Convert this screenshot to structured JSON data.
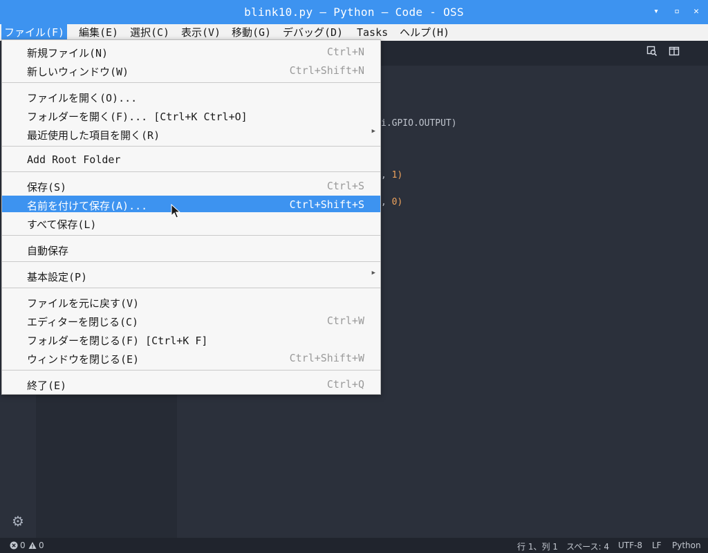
{
  "window": {
    "title": "blink10.py — Python — Code - OSS",
    "minimize_label": "▾",
    "maximize_label": "▫",
    "close_label": "✕"
  },
  "menubar": {
    "items": [
      {
        "label": "ファイル(F)"
      },
      {
        "label": "編集(E)"
      },
      {
        "label": "選択(C)"
      },
      {
        "label": "表示(V)"
      },
      {
        "label": "移動(G)"
      },
      {
        "label": "デバッグ(D)"
      },
      {
        "label": "Tasks"
      },
      {
        "label": "ヘルプ(H)"
      }
    ]
  },
  "file_menu": {
    "items": [
      {
        "label": "新規ファイル(N)",
        "shortcut": "Ctrl+N"
      },
      {
        "label": "新しいウィンドウ(W)",
        "shortcut": "Ctrl+Shift+N"
      },
      {
        "label": "ファイルを開く(O)...",
        "shortcut": ""
      },
      {
        "label": "フォルダーを開く(F)... [Ctrl+K Ctrl+O]",
        "shortcut": ""
      },
      {
        "label": "最近使用した項目を開く(R)",
        "shortcut": ""
      },
      {
        "label": "Add Root Folder",
        "shortcut": ""
      },
      {
        "label": "保存(S)",
        "shortcut": "Ctrl+S"
      },
      {
        "label": "名前を付けて保存(A)...",
        "shortcut": "Ctrl+Shift+S"
      },
      {
        "label": "すべて保存(L)",
        "shortcut": ""
      },
      {
        "label": "自動保存",
        "shortcut": ""
      },
      {
        "label": "基本設定(P)",
        "shortcut": ""
      },
      {
        "label": "ファイルを元に戻す(V)",
        "shortcut": ""
      },
      {
        "label": "エディターを閉じる(C)",
        "shortcut": "Ctrl+W"
      },
      {
        "label": "フォルダーを閉じる(F) [Ctrl+K F]",
        "shortcut": ""
      },
      {
        "label": "ウィンドウを閉じる(E)",
        "shortcut": "Ctrl+Shift+W"
      },
      {
        "label": "終了(E)",
        "shortcut": "Ctrl+Q"
      }
    ],
    "highlighted_index": 7
  },
  "editor": {
    "code_fragments": {
      "line1": "i.GPIO.OUTPUT)",
      "line2_sep": ", ",
      "line2_num": "1)",
      "line3_sep": ", ",
      "line3_num": "0)"
    }
  },
  "statusbar": {
    "errors": "0",
    "warnings": "0",
    "position": "行 1、列 1",
    "indent": "スペース: 4",
    "encoding": "UTF-8",
    "eol": "LF",
    "language": "Python"
  },
  "colors": {
    "accent": "#3d93f0",
    "editor_bg": "#2b303b",
    "number": "#f0a45d"
  }
}
